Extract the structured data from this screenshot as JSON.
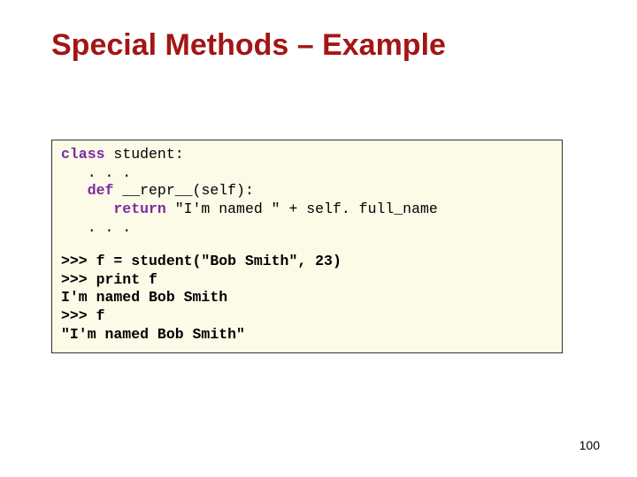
{
  "title": "Special Methods – Example",
  "code": {
    "l1a": "class",
    "l1b": " student:",
    "l2": "   . . .",
    "l3a": "   def",
    "l3b": " __repr__(self):",
    "l4a": "      return",
    "l4b": " \"I'm named \" + self. full_name",
    "l5": "   . . ."
  },
  "session": {
    "s1": ">>> f = student(\"Bob Smith\", 23)",
    "s2": ">>> print f",
    "s3": "I'm named Bob Smith",
    "s4": ">>> f",
    "s5": "\"I'm named Bob Smith\""
  },
  "page_number": "100"
}
